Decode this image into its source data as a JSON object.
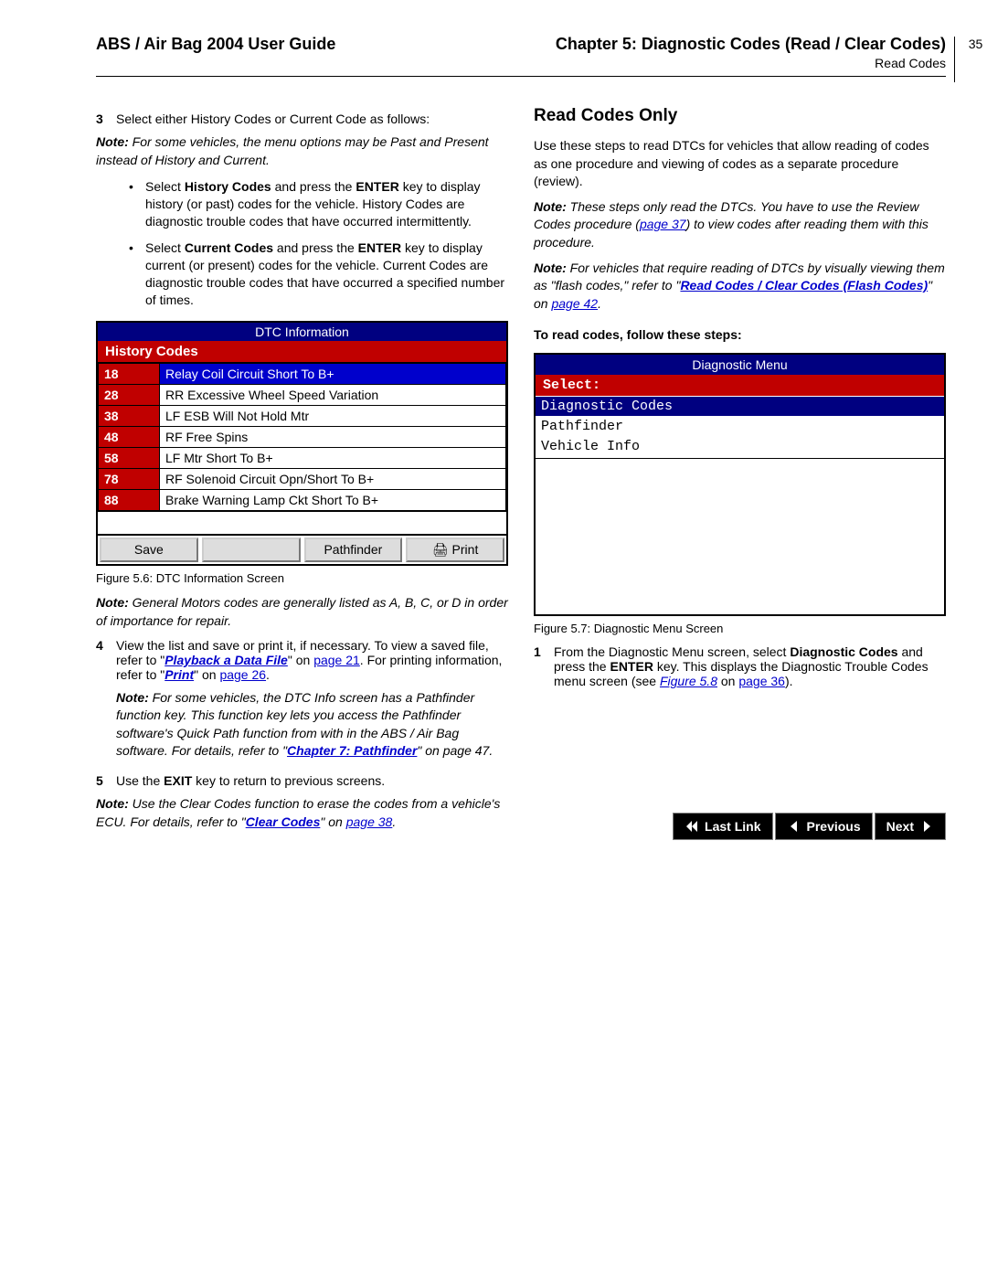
{
  "header": {
    "title": "ABS / Air Bag 2004 User Guide",
    "chapter": "Chapter 5: Diagnostic Codes (Read / Clear Codes)",
    "subtitle": "Read Codes",
    "page_number": "35"
  },
  "left": {
    "step3_num": "3",
    "step3_text": "Select either History Codes or Current Code as follows:",
    "step3_note": "For some vehicles, the menu options may be Past and Present instead of History and Current.",
    "bullet1_pre": "Select ",
    "bullet1_bold": "History Codes",
    "bullet1_mid": " and press the ",
    "bullet1_bold2": "ENTER",
    "bullet1_post": " key to display history (or past) codes for the vehicle. History Codes are diagnostic trouble codes that have occurred intermittently.",
    "bullet2_pre": "Select ",
    "bullet2_bold": "Current Codes",
    "bullet2_mid": " and press the ",
    "bullet2_bold2": "ENTER",
    "bullet2_post": " key to display current (or present) codes for the vehicle. Current Codes are diagnostic trouble codes that have occurred a specified number of times.",
    "fig56": {
      "title": "DTC Information",
      "subtitle": "History Codes",
      "rows": [
        {
          "code": "18",
          "desc": "Relay Coil Circuit Short To B+",
          "sel": true
        },
        {
          "code": "28",
          "desc": "RR Excessive Wheel Speed Variation"
        },
        {
          "code": "38",
          "desc": "LF ESB Will Not Hold Mtr"
        },
        {
          "code": "48",
          "desc": "RF Free Spins"
        },
        {
          "code": "58",
          "desc": "LF Mtr Short To B+"
        },
        {
          "code": "78",
          "desc": "RF Solenoid Circuit Opn/Short To B+"
        },
        {
          "code": "88",
          "desc": "Brake Warning Lamp Ckt Short To B+"
        }
      ],
      "buttons": [
        "Save",
        "",
        "Pathfinder",
        "🖨  Print"
      ],
      "caption": "Figure 5.6: DTC Information Screen"
    },
    "note_gm": "General Motors codes are generally listed as A, B, C, or D in order of importance for repair.",
    "step4_num": "4",
    "step4_a": "View the list and save or print it, if necessary. To view a saved file, refer to \"",
    "step4_link1": "Playback a Data File",
    "step4_b": "\" on ",
    "step4_link2": "page 21",
    "step4_c": ". For printing information, refer to \"",
    "step4_link3": "Print",
    "step4_d": "\" on ",
    "step4_link4": "page 26",
    "step4_e": ".",
    "step4_note_a": "For some vehicles, the DTC Info screen has a Pathfinder function key. This function key lets you access the Pathfinder software's Quick Path function from with in the ABS / Air Bag software. For details, refer to \"",
    "step4_note_link": "Chapter 7: Pathfinder",
    "step4_note_b": "\" on page 47.",
    "step5_num": "5",
    "step5_a": "Use the ",
    "step5_bold": "EXIT",
    "step5_b": " key to return to previous screens.",
    "note_clear_a": "Use the Clear Codes function to erase the codes from a vehicle's ECU. For details, refer to \"",
    "note_clear_link": "Clear Codes",
    "note_clear_b": "\" on ",
    "note_clear_link2": "page 38",
    "note_clear_c": "."
  },
  "right": {
    "h3": "Read Codes Only",
    "p1": "Use these steps to read DTCs for vehicles that allow reading of codes as one procedure and viewing of codes as a separate procedure (review).",
    "note1_a": "These steps only read the DTCs. You have to use the Review Codes procedure (",
    "note1_link": "page 37",
    "note1_b": ") to view codes after reading them with this procedure.",
    "note2_a": "For vehicles that require reading of DTCs by visually viewing them as \"flash codes,\" refer to \"",
    "note2_link": "Read Codes / Clear Codes (Flash Codes)",
    "note2_b": "\" on ",
    "note2_link2": "page 42",
    "note2_c": ".",
    "sub_bold": "To read codes, follow these steps:",
    "fig57": {
      "title": "Diagnostic Menu",
      "select": "Select:",
      "items": [
        {
          "label": "Diagnostic Codes",
          "sel": true
        },
        {
          "label": "Pathfinder"
        },
        {
          "label": "Vehicle Info"
        }
      ],
      "caption": "Figure 5.7: Diagnostic Menu Screen"
    },
    "step1_num": "1",
    "step1_a": "From the Diagnostic Menu screen, select ",
    "step1_bold": "Diagnostic Codes",
    "step1_b": " and press the ",
    "step1_bold2": "ENTER",
    "step1_c": " key. This displays the Diagnostic Trouble Codes menu screen (see ",
    "step1_link": "Figure 5.8",
    "step1_d": " on ",
    "step1_link2": "page 36",
    "step1_e": ")."
  },
  "footer": {
    "last_link": "Last Link",
    "previous": "Previous",
    "next": "Next"
  },
  "labels": {
    "note": "Note:"
  }
}
